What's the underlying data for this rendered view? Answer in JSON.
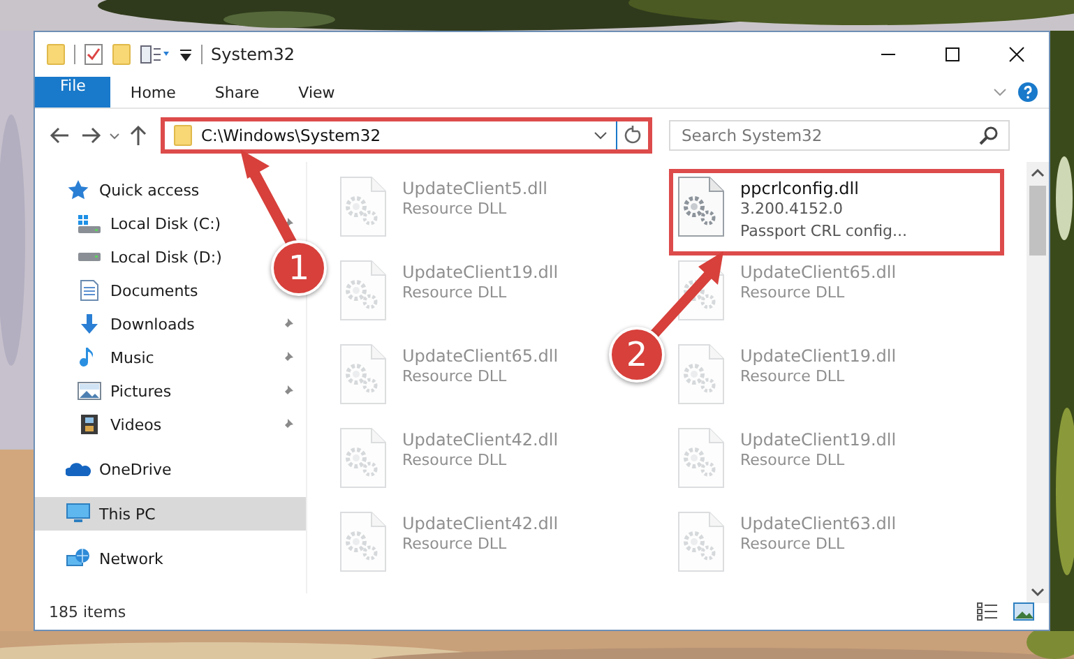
{
  "window": {
    "title": "System32"
  },
  "ribbon": {
    "tabs": [
      {
        "label": "File",
        "kind": "file",
        "selected": false
      },
      {
        "label": "Home",
        "kind": "plain",
        "selected": false
      },
      {
        "label": "Share",
        "kind": "plain",
        "selected": false
      },
      {
        "label": "View",
        "kind": "plain",
        "selected": false
      }
    ]
  },
  "address": {
    "path": "C:\\Windows\\System32",
    "highlighted": true
  },
  "search": {
    "placeholder": "Search System32"
  },
  "sidebar": {
    "items": [
      {
        "label": "Quick access",
        "kind": "quickaccess",
        "selected": false,
        "children": [
          {
            "label": "Local Disk (C:)",
            "kind": "systemdisk",
            "pinned": true,
            "selected": false
          },
          {
            "label": "Local Disk (D:)",
            "kind": "disk",
            "pinned": false,
            "selected": false
          },
          {
            "label": "Documents",
            "kind": "documents",
            "pinned": false,
            "selected": false
          },
          {
            "label": "Downloads",
            "kind": "downloads",
            "pinned": true,
            "selected": false
          },
          {
            "label": "Music",
            "kind": "music",
            "pinned": true,
            "selected": false
          },
          {
            "label": "Pictures",
            "kind": "pictures",
            "pinned": true,
            "selected": false
          },
          {
            "label": "Videos",
            "kind": "videos",
            "pinned": true,
            "selected": false
          }
        ]
      },
      {
        "label": "OneDrive",
        "kind": "onedrive",
        "selected": false
      },
      {
        "label": "This PC",
        "kind": "pc",
        "selected": true
      },
      {
        "label": "Network",
        "kind": "network",
        "selected": false
      }
    ]
  },
  "files": [
    {
      "name": "UpdateClient5.dll",
      "details": [
        "Resource DLL"
      ],
      "faded": true,
      "highlighted": false
    },
    {
      "name": "ppcrlconfig.dll",
      "details": [
        "3.200.4152.0",
        "Passport CRL config..."
      ],
      "faded": false,
      "highlighted": true
    },
    {
      "name": "UpdateClient19.dll",
      "details": [
        "Resource DLL"
      ],
      "faded": true,
      "highlighted": false
    },
    {
      "name": "UpdateClient65.dll",
      "details": [
        "Resource DLL"
      ],
      "faded": true,
      "highlighted": false
    },
    {
      "name": "UpdateClient65.dll",
      "details": [
        "Resource DLL"
      ],
      "faded": true,
      "highlighted": false
    },
    {
      "name": "UpdateClient19.dll",
      "details": [
        "Resource DLL"
      ],
      "faded": true,
      "highlighted": false
    },
    {
      "name": "UpdateClient42.dll",
      "details": [
        "Resource DLL"
      ],
      "faded": true,
      "highlighted": false
    },
    {
      "name": "UpdateClient19.dll",
      "details": [
        "Resource DLL"
      ],
      "faded": true,
      "highlighted": false
    },
    {
      "name": "UpdateClient42.dll",
      "details": [
        "Resource DLL"
      ],
      "faded": true,
      "highlighted": false
    },
    {
      "name": "UpdateClient63.dll",
      "details": [
        "Resource DLL"
      ],
      "faded": true,
      "highlighted": false
    }
  ],
  "status_bar": {
    "count": "185 items"
  },
  "annotations": [
    {
      "label": "1"
    },
    {
      "label": "2"
    }
  ]
}
